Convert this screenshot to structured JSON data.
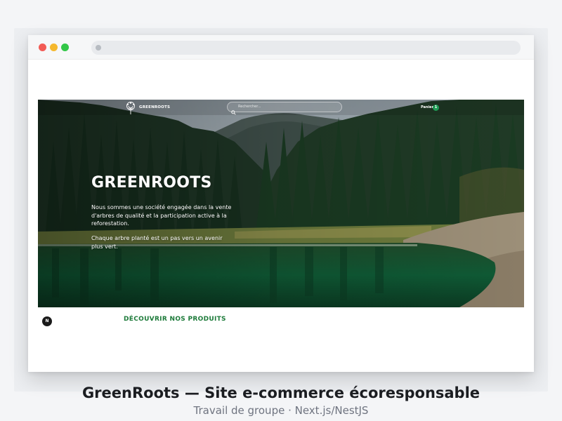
{
  "browser": {
    "url": ""
  },
  "site": {
    "logo_text": "GREENROOTS",
    "search_placeholder": "Rechercher...",
    "cart_label": "Panier",
    "cart_count": "1"
  },
  "hero": {
    "title": "GREENROOTS",
    "paragraph_1": "Nous sommes une société engagée dans la vente d'arbres de qualité et la participation active à la reforestation.",
    "paragraph_2": "Chaque arbre planté est un pas vers un avenir plus vert."
  },
  "cta": {
    "label": "DÉCOUVRIR NOS PRODUITS"
  },
  "dev_badge": {
    "label": "N"
  },
  "caption": {
    "title": "GreenRoots — Site e-commerce écoresponsable",
    "subtitle": "Travail de groupe · Next.js/NestJS"
  },
  "colors": {
    "accent_green": "#1c7a39",
    "badge_green": "#1f9b55",
    "traffic_red": "#f25b55",
    "traffic_yellow": "#f5b82e",
    "traffic_green": "#33c748"
  },
  "icons": {
    "logo": "tree-icon",
    "search": "search-icon"
  }
}
